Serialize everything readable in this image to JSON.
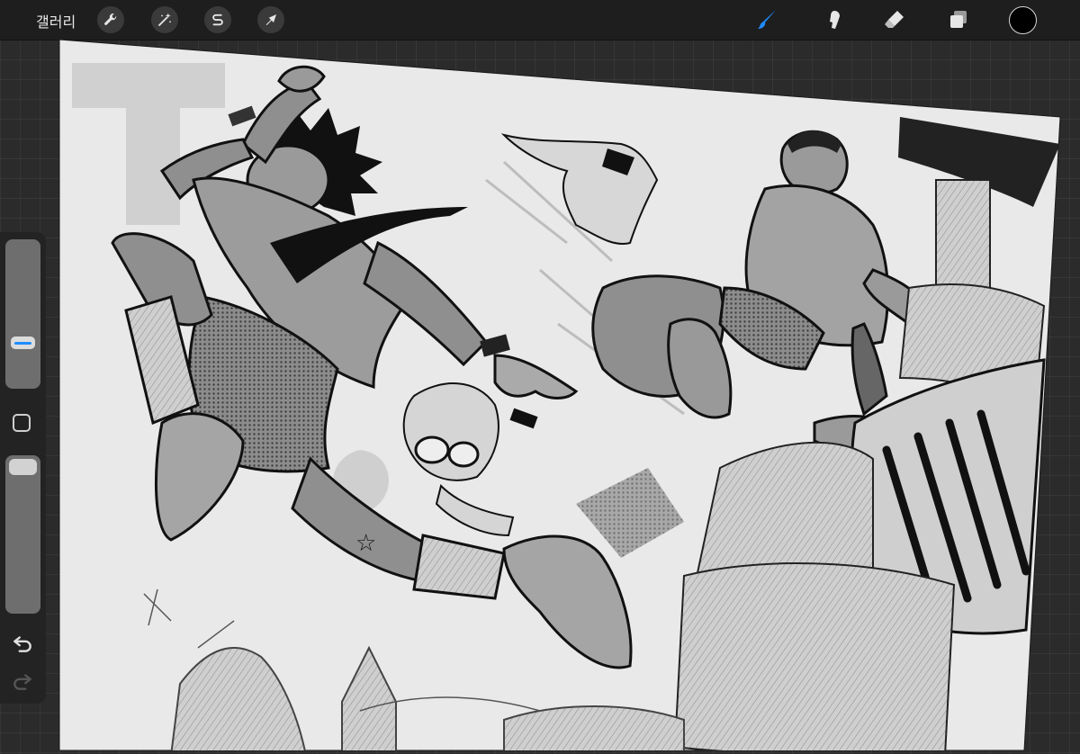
{
  "topbar": {
    "gallery_label": "갤러리",
    "actions": [
      {
        "name": "actions-button",
        "icon": "wrench-icon"
      },
      {
        "name": "adjustments-button",
        "icon": "magic-wand-icon"
      },
      {
        "name": "selection-button",
        "icon": "selection-s-icon"
      },
      {
        "name": "transform-button",
        "icon": "arrow-cursor-icon"
      }
    ],
    "tools": [
      {
        "name": "brush-tool",
        "icon": "brush-icon",
        "active": true
      },
      {
        "name": "smudge-tool",
        "icon": "smudge-icon",
        "active": false
      },
      {
        "name": "eraser-tool",
        "icon": "eraser-icon",
        "active": false
      },
      {
        "name": "layers-button",
        "icon": "layers-icon",
        "active": false
      }
    ],
    "current_color": "#000000"
  },
  "sidebar": {
    "brush_size_level": 0.29,
    "opacity_level": 1.0,
    "undo_icon": "undo-icon",
    "redo_icon": "redo-icon"
  },
  "theme": {
    "accent": "#1e8cff",
    "bar_bg": "#1e1e1e",
    "canvas_paper": "#e9e9e9"
  }
}
